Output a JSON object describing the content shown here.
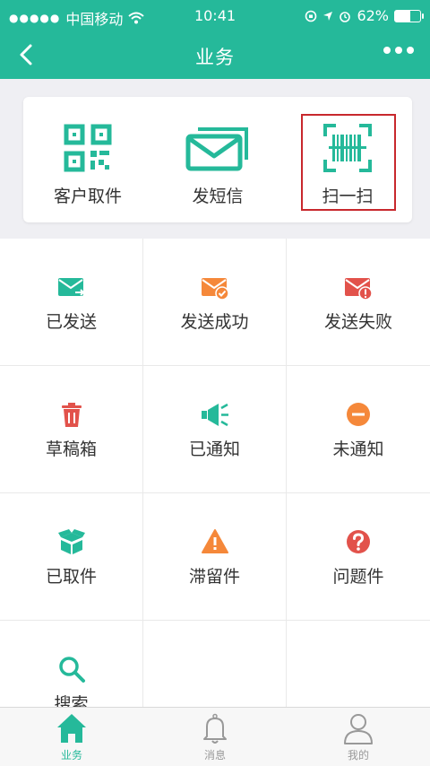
{
  "colors": {
    "brand": "#25b99a",
    "orange": "#f5883a",
    "red": "#e2524b"
  },
  "status_bar": {
    "carrier": "中国移动",
    "time": "10:41",
    "battery": "62%",
    "battery_level": 0.62
  },
  "nav": {
    "title": "业务",
    "back_icon": "back-chevron-icon",
    "more_icon": "more-dots-icon"
  },
  "quick_actions": [
    {
      "label": "客户取件",
      "icon": "qr-code-icon"
    },
    {
      "label": "发短信",
      "icon": "envelope-icon"
    },
    {
      "label": "扫一扫",
      "icon": "barcode-scan-icon"
    }
  ],
  "grid": [
    {
      "label": "已发送",
      "icon": "mail-sent-icon"
    },
    {
      "label": "发送成功",
      "icon": "mail-success-icon"
    },
    {
      "label": "发送失败",
      "icon": "mail-failed-icon"
    },
    {
      "label": "草稿箱",
      "icon": "trash-icon"
    },
    {
      "label": "已通知",
      "icon": "megaphone-icon"
    },
    {
      "label": "未通知",
      "icon": "minus-circle-icon"
    },
    {
      "label": "已取件",
      "icon": "box-icon"
    },
    {
      "label": "滞留件",
      "icon": "warning-icon"
    },
    {
      "label": "问题件",
      "icon": "question-icon"
    },
    {
      "label": "搜索",
      "icon": "search-icon"
    }
  ],
  "tabs": [
    {
      "label": "业务",
      "icon": "home-icon",
      "active": true
    },
    {
      "label": "消息",
      "icon": "bell-icon"
    },
    {
      "label": "我的",
      "icon": "person-icon"
    }
  ]
}
